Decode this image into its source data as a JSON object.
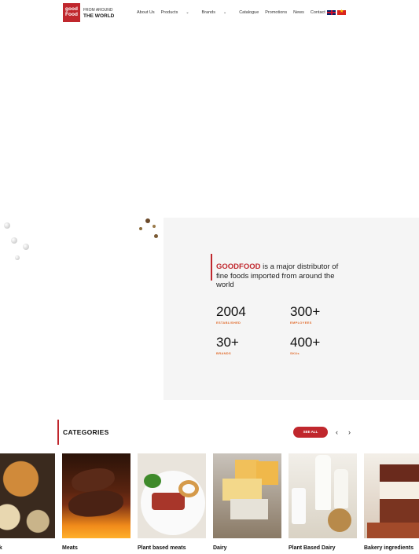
{
  "header": {
    "logo_line1": "good",
    "logo_line2": "Food",
    "tagline_top": "FROM AROUND",
    "tagline_bottom": "THE WORLD",
    "nav": [
      {
        "label": "About Us"
      },
      {
        "label": "Products"
      },
      {
        "label": "Brands"
      },
      {
        "label": "Catalogue"
      },
      {
        "label": "Promotions"
      },
      {
        "label": "News"
      },
      {
        "label": "Contact"
      }
    ],
    "languages": [
      "uk-flag-icon",
      "vn-flag-icon"
    ]
  },
  "about": {
    "brand": "GOODFOOD",
    "text": " is a major distributor of fine foods imported from around the world",
    "stats": [
      {
        "value": "2004",
        "label": "ESTABLISHED"
      },
      {
        "value": "300+",
        "label": "EMPLOYEES"
      },
      {
        "value": "30+",
        "label": "BRANDS"
      },
      {
        "value": "400+",
        "label": "SKUs"
      }
    ]
  },
  "categories": {
    "title": "CATEGORIES",
    "see_all": "SEE ALL",
    "prev": "‹",
    "next": "›",
    "items": [
      {
        "label": "ck"
      },
      {
        "label": "Meats"
      },
      {
        "label": "Plant based meats"
      },
      {
        "label": "Dairy"
      },
      {
        "label": "Plant Based Dairy"
      },
      {
        "label": "Bakery ingredients"
      }
    ]
  },
  "colors": {
    "brand_red": "#c0272d",
    "accent_orange": "#e06a2a",
    "panel_grey": "#f5f5f5"
  }
}
